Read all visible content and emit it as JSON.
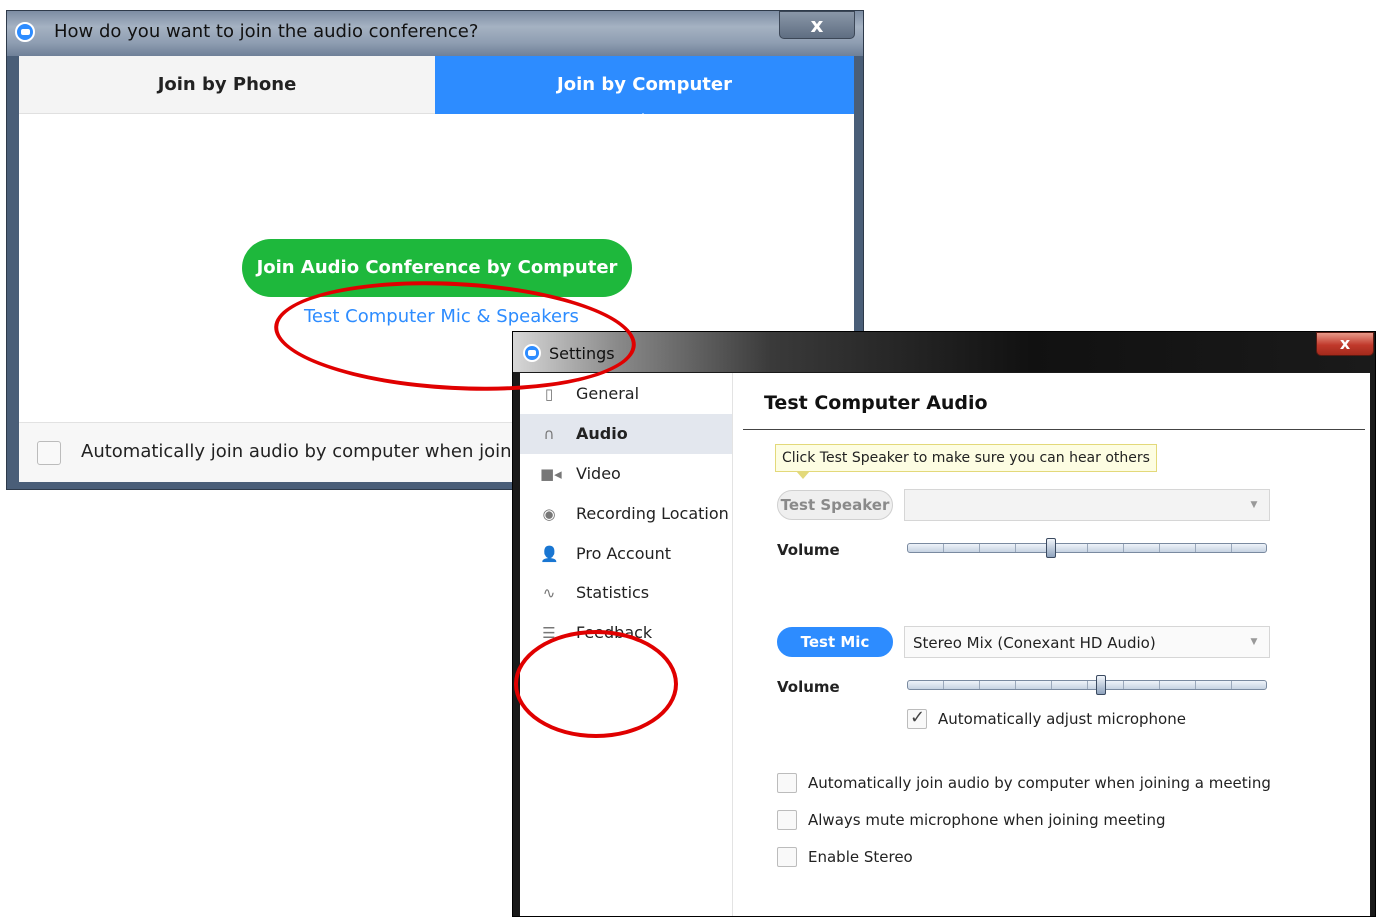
{
  "join_dialog": {
    "title": "How do you want to join the audio conference?",
    "close_label": "x",
    "tabs": [
      {
        "label": "Join by Phone",
        "active": false
      },
      {
        "label": "Join by Computer",
        "active": true
      }
    ],
    "join_button": "Join Audio Conference by Computer",
    "test_link": "Test Computer Mic & Speakers",
    "auto_join_label": "Automatically join audio by computer when joining a meeting",
    "auto_join_checked": false
  },
  "settings": {
    "title": "Settings",
    "close_label": "x",
    "nav": [
      {
        "label": "General",
        "icon": "phone-icon",
        "active": false
      },
      {
        "label": "Audio",
        "icon": "headphones-icon",
        "active": true
      },
      {
        "label": "Video",
        "icon": "video-camera-icon",
        "active": false
      },
      {
        "label": "Recording Location",
        "icon": "record-icon",
        "active": false
      },
      {
        "label": "Pro Account",
        "icon": "user-icon",
        "active": false
      },
      {
        "label": "Statistics",
        "icon": "pulse-icon",
        "active": false
      },
      {
        "label": "Feedback",
        "icon": "feedback-icon",
        "active": false
      }
    ],
    "section_title": "Test Computer Audio",
    "tooltip": "Click Test Speaker to make sure you can hear others",
    "speaker": {
      "button": "Test Speaker",
      "device": "",
      "volume_label": "Volume",
      "volume_level": 0.4
    },
    "mic": {
      "button": "Test Mic",
      "device": "Stereo Mix (Conexant HD Audio)",
      "volume_label": "Volume",
      "volume_level": 0.54,
      "auto_adjust_label": "Automatically adjust microphone",
      "auto_adjust_checked": true
    },
    "options": [
      {
        "label": "Automatically join audio by computer when joining a meeting",
        "checked": false
      },
      {
        "label": "Always mute microphone when joining meeting",
        "checked": false
      },
      {
        "label": "Enable Stereo",
        "checked": false
      }
    ]
  },
  "colors": {
    "accent_blue": "#2d8cff",
    "join_green": "#1eb83c",
    "annotation_red": "#e00000"
  }
}
